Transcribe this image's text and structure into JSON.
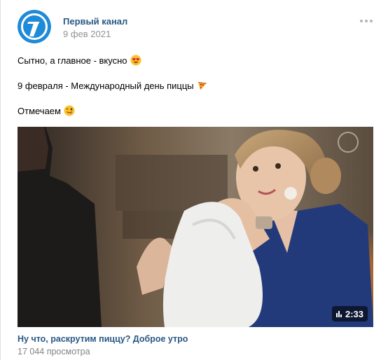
{
  "post": {
    "author": "Первый канал",
    "date": "9 фев 2021",
    "avatar_icon": "channel-one-logo-icon",
    "more_icon": "more-dots-icon",
    "text_lines": [
      {
        "text": "Сытно, а главное - вкусно",
        "emoji": "heart-eyes-emoji-icon"
      },
      {
        "text": "9 февраля - Международный день пиццы",
        "emoji": "pizza-emoji-icon"
      },
      {
        "text": "Отмечаем",
        "emoji": "winking-tongue-emoji-icon"
      }
    ]
  },
  "video": {
    "title": "Ну что, раскрутим пиццу? Доброе утро",
    "views": "17 044 просмотра",
    "duration": "2:33",
    "duration_icon": "video-bars-icon",
    "colors": {
      "link": "#2a5885",
      "muted": "#939393",
      "logo_blue": "#1e8ad8"
    }
  }
}
